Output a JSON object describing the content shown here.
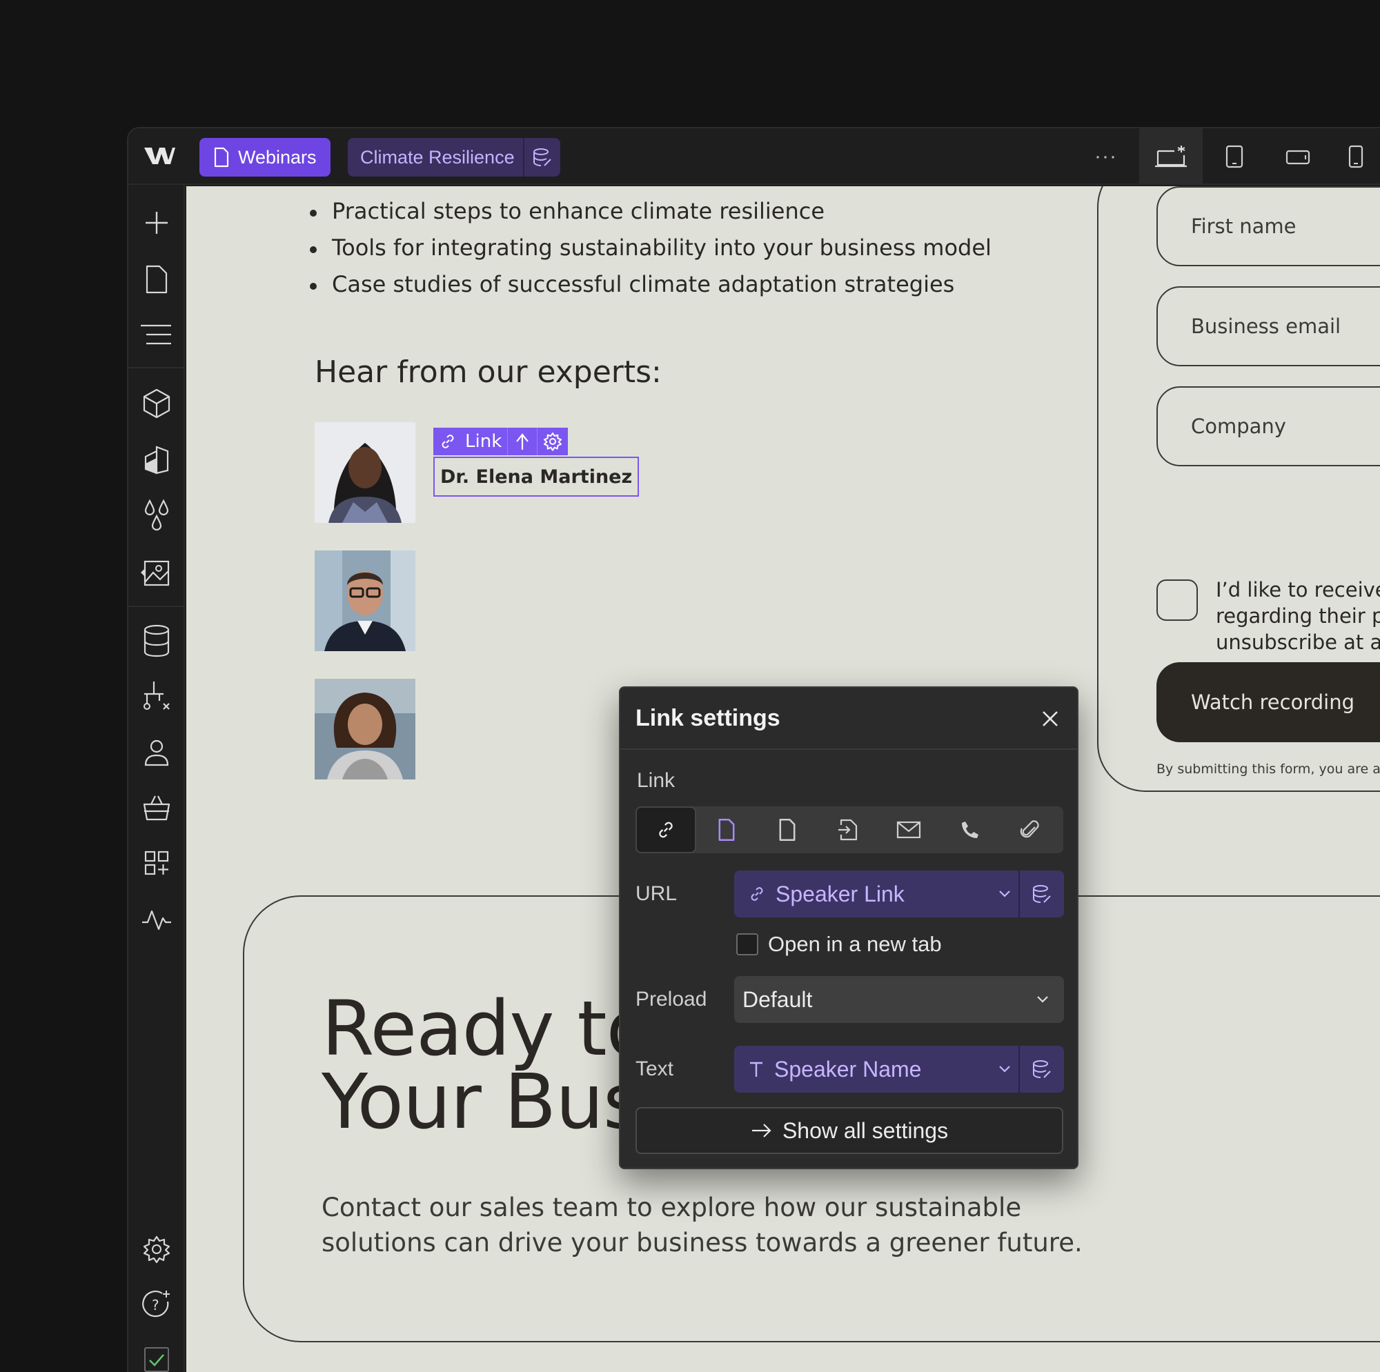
{
  "topbar": {
    "page_tab": "Webinars",
    "collection_tab": "Climate Resilience",
    "more": "···"
  },
  "canvas": {
    "bullets": [
      "Practical steps to enhance climate resilience",
      "Tools for integrating sustainability into your business model",
      "Case studies of successful climate adaptation strategies"
    ],
    "experts_heading": "Hear from our experts:",
    "link_tag_label": "Link",
    "selected_name": "Dr. Elena Martinez",
    "form": {
      "first_name": "First name",
      "business_email": "Business email",
      "company": "Company",
      "consent_lines": [
        "I’d like to receive n",
        "regarding their pr",
        "unsubscribe at an"
      ],
      "submit": "Watch recording",
      "fine_print": "By submitting this form, you are agr"
    },
    "cta": {
      "heading_line1": "Ready to Transform",
      "heading_line2": "Your Business?",
      "body_line1": "Contact our sales team to explore how our sustainable",
      "body_line2": "solutions can drive your business towards a greener future."
    }
  },
  "link_settings": {
    "title": "Link settings",
    "link_label": "Link",
    "link_types": [
      "url-link-icon",
      "page-icon",
      "collection-page-icon",
      "section-anchor-icon",
      "email-icon",
      "phone-icon",
      "attachment-icon"
    ],
    "url_label": "URL",
    "url_value": "Speaker Link",
    "new_tab_label": "Open in a new tab",
    "preload_label": "Preload",
    "preload_value": "Default",
    "text_label": "Text",
    "text_value": "Speaker Name",
    "show_all": "Show all settings"
  },
  "colors": {
    "accent": "#6e45e2",
    "canvas_bg": "#dfe1d8",
    "cms_binding": "#3d3466",
    "cms_text": "#c6b6ff"
  }
}
